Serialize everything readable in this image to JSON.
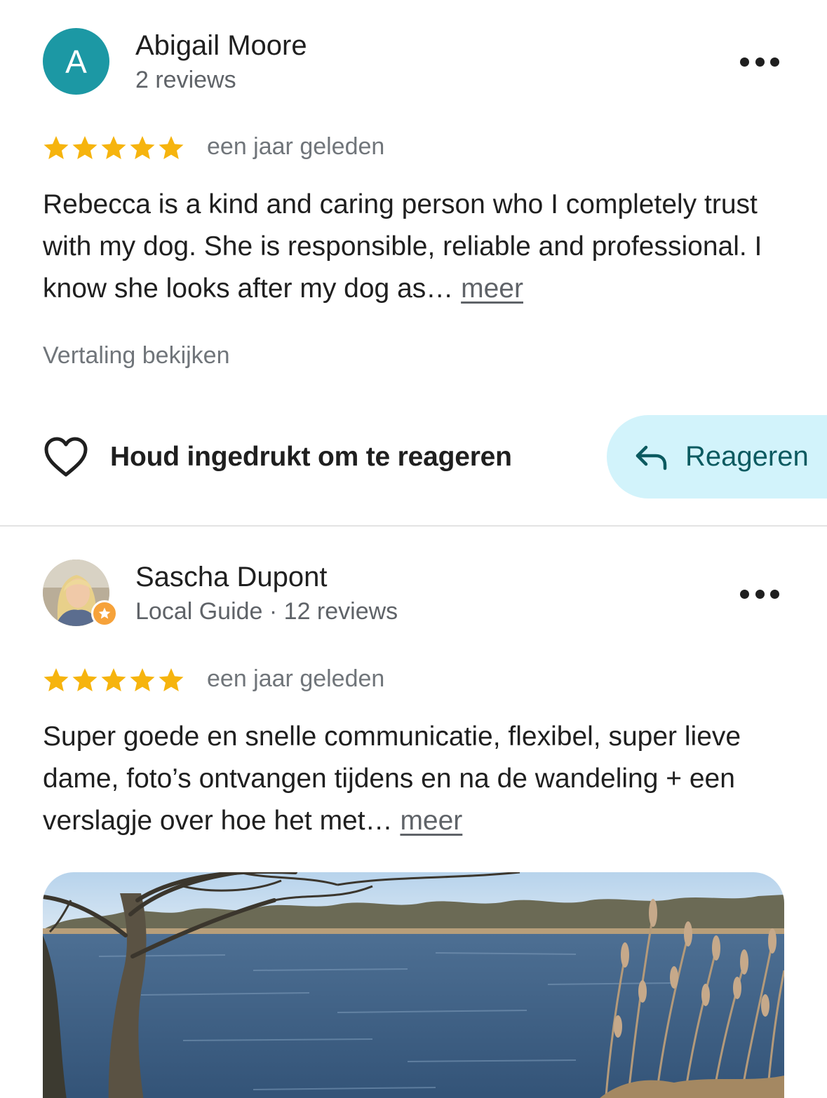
{
  "reviews": [
    {
      "avatar_letter": "A",
      "avatar_color": "#1c98a4",
      "name": "Abigail Moore",
      "subtitle": "2 reviews",
      "rating": 5,
      "date": "een jaar geleden",
      "text": "Rebecca is a kind and caring person who I completely trust with my dog. She is responsible, reliable and professional. I know she looks after my dog as…",
      "more_label": "meer",
      "translate_label": "Vertaling bekijken",
      "like_label": "Houd ingedrukt om te reageren",
      "reply_label": "Reageren",
      "more_options_icon": "more-horizontal-icon"
    },
    {
      "avatar_type": "photo",
      "badge_icon": "local-guide-star-icon",
      "name": "Sascha Dupont",
      "subtitle": "Local Guide · 12 reviews",
      "rating": 5,
      "date": "een jaar geleden",
      "text": "Super goede en snelle communicatie, flexibel, super lieve dame, foto’s ontvangen tijdens en na de wandeling + een verslagje over hoe het met…",
      "more_label": "meer",
      "photo_description": "lake-with-trees-and-reeds-photo",
      "more_options_icon": "more-horizontal-icon"
    }
  ],
  "colors": {
    "star": "#f6b40e",
    "reply_bg": "#d2f3fb",
    "reply_text": "#0b5a60",
    "secondary_text": "#70757a"
  }
}
